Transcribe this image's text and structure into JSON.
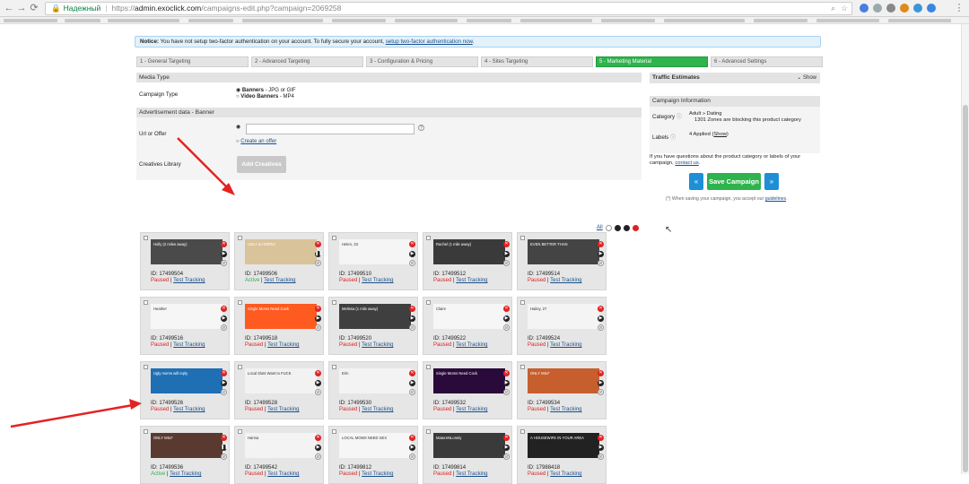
{
  "browser": {
    "secure_label": "Надежный",
    "url_host": "admin.exoclick.com",
    "url_path": "/campaigns-edit.php?campaign=2069258",
    "url_proto": "https://"
  },
  "notice": {
    "label": "Notice:",
    "text": " You have not setup two-factor authentication on your account. To fully secure your account, ",
    "link": "setup two-factor authentication now",
    "tail": "."
  },
  "steps": [
    "1 - General Targeting",
    "2 - Advanced Targeting",
    "3 - Configuration & Pricing",
    "4 - Sites Targeting",
    "5 - Marketing Material",
    "6 - Advanced Settings"
  ],
  "active_step": 4,
  "media": {
    "heading": "Media Type",
    "campaign_type_label": "Campaign Type",
    "option1": "Banners",
    "option1_suffix": " - JPG or GIF",
    "option2": "Video Banners",
    "option2_suffix": " - MP4"
  },
  "ad_data": {
    "heading": "Advertisement data - Banner",
    "url_label": "Url or Offer",
    "create_offer": "Create an offer",
    "creatives_label": "Creatives Library",
    "add_creatives": "Add Creatives",
    "help": "?",
    "select_all": "All"
  },
  "sidebar": {
    "traffic_heading": "Traffic Estimates",
    "show": "Show",
    "info_heading": "Campaign Information",
    "category_label": "Category",
    "category_value": "Adult » Dating",
    "zones_note": "1301 Zones are blocking this product category",
    "labels_label": "Labels",
    "labels_value": "4 Applied (",
    "labels_link": "Show",
    "labels_close": ")",
    "question": "If you have questions about the product category or labels of your campaign, ",
    "contact_link": "contact us",
    "contact_tail": ".",
    "save_button": "Save Campaign",
    "prev": "«",
    "next": "»",
    "save_note": "(*) When saving your campaign, you accept our ",
    "guidelines": "guidelines",
    "guidelines_tail": "."
  },
  "status_labels": {
    "paused": "Paused",
    "active": "Active",
    "separator": " | ",
    "test": "Test Tracking",
    "id_prefix": "ID: "
  },
  "creatives": [
    {
      "id": "17499504",
      "status": "Paused",
      "text": "Holly (2 miles away)",
      "color": "#4a4a4a"
    },
    {
      "id": "17499506",
      "status": "Active",
      "text": "UGLY & HORNY",
      "color": "#d9c39a"
    },
    {
      "id": "17499510",
      "status": "Paused",
      "text": "Helen, 33",
      "color": "#f5f5f5"
    },
    {
      "id": "17499512",
      "status": "Paused",
      "text": "Rachel (1 mile away)",
      "color": "#3a3a3a"
    },
    {
      "id": "17499514",
      "status": "Paused",
      "text": "EVEN BETTER THAN",
      "color": "#444"
    },
    {
      "id": "17499516",
      "status": "Paused",
      "text": "Heather",
      "color": "#f6f6f6"
    },
    {
      "id": "17499518",
      "status": "Paused",
      "text": "Single Moms Need Cock",
      "color": "#ff5a1f"
    },
    {
      "id": "17499520",
      "status": "Paused",
      "text": "Melissa (1 mile away)",
      "color": "#3f3f3f"
    },
    {
      "id": "17499522",
      "status": "Paused",
      "text": "Claire",
      "color": "#f6f6f6"
    },
    {
      "id": "17499524",
      "status": "Paused",
      "text": "Hailey, 27",
      "color": "#f4f4f4"
    },
    {
      "id": "17499526",
      "status": "Paused",
      "text": "Ugly moms will reply",
      "color": "#1f6fb5"
    },
    {
      "id": "17499528",
      "status": "Paused",
      "text": "Local Sluts Want to FUCK",
      "color": "#f2f2f2"
    },
    {
      "id": "17499530",
      "status": "Paused",
      "text": "Erin",
      "color": "#f3f3f3"
    },
    {
      "id": "17499532",
      "status": "Paused",
      "text": "Single Moms Need Cock",
      "color": "#2a0a3a"
    },
    {
      "id": "17499534",
      "status": "Paused",
      "text": "ONLY MILF",
      "color": "#c65f2d"
    },
    {
      "id": "17499536",
      "status": "Active",
      "text": "ONLY MILF",
      "color": "#5a3a30"
    },
    {
      "id": "17499542",
      "status": "Paused",
      "text": "Hanna",
      "color": "#f3f3f3"
    },
    {
      "id": "17499812",
      "status": "Paused",
      "text": "LOCAL MOMS NEED SEX",
      "color": "#f6f6f6"
    },
    {
      "id": "17499814",
      "status": "Paused",
      "text": "MatureNLonely",
      "color": "#3a3a3a"
    },
    {
      "id": "17988418",
      "status": "Paused",
      "text": "A HOUSEWIFE IN YOUR AREA",
      "color": "#222"
    }
  ],
  "colors": {
    "active_step": "#2fb34d",
    "button_blue": "#1d8fd6",
    "paused": "#dd2222",
    "active": "#2fb34d",
    "arrow": "#e52222"
  }
}
